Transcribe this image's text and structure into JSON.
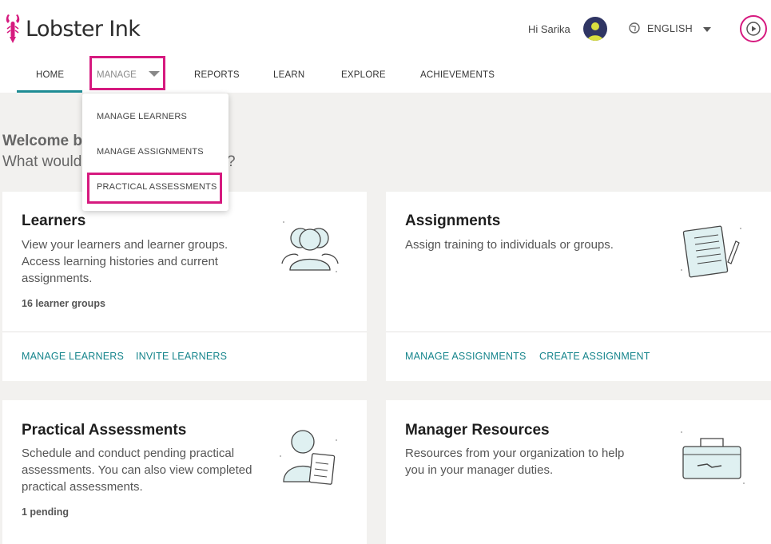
{
  "app": {
    "logo_text": "Lobster Ink",
    "brand_color": "#d61a7f",
    "accent_color": "#16858c"
  },
  "header": {
    "greeting": "Hi Sarika",
    "avatar_icon": "user-avatar-icon",
    "language": "ENGLISH",
    "globe_icon": "globe-icon",
    "play_icon": "play-icon"
  },
  "nav": {
    "items": [
      {
        "label": "HOME",
        "active": true
      },
      {
        "label": "MANAGE",
        "active": false,
        "dropdown_open": true
      },
      {
        "label": "REPORTS"
      },
      {
        "label": "LEARN"
      },
      {
        "label": "EXPLORE"
      },
      {
        "label": "ACHIEVEMENTS"
      }
    ]
  },
  "manage_menu": {
    "items": [
      {
        "label": "MANAGE LEARNERS"
      },
      {
        "label": "MANAGE ASSIGNMENTS"
      },
      {
        "label": "PRACTICAL ASSESSMENTS",
        "highlighted": true
      }
    ]
  },
  "welcome": {
    "line1": "Welcome b",
    "line2_left": "What would",
    "line2_right": "?"
  },
  "cards": [
    {
      "title": "Learners",
      "description": "View your learners and learner groups. Access learning histories and current assignments.",
      "meta": "16 learner groups",
      "links": [
        "MANAGE LEARNERS",
        "INVITE LEARNERS"
      ],
      "icon": "learners-group-icon"
    },
    {
      "title": "Assignments",
      "description": "Assign training to individuals or groups.",
      "meta": "",
      "links": [
        "MANAGE ASSIGNMENTS",
        "CREATE ASSIGNMENT"
      ],
      "icon": "notebook-pencil-icon"
    },
    {
      "title": "Practical Assessments",
      "description": "Schedule and conduct pending practical assessments. You can also view completed practical assessments.",
      "meta": "1 pending",
      "links": [],
      "icon": "person-clipboard-icon"
    },
    {
      "title": "Manager Resources",
      "description": "Resources from your organization to help you in your manager duties.",
      "meta": "",
      "links": [],
      "icon": "toolbox-icon"
    }
  ]
}
